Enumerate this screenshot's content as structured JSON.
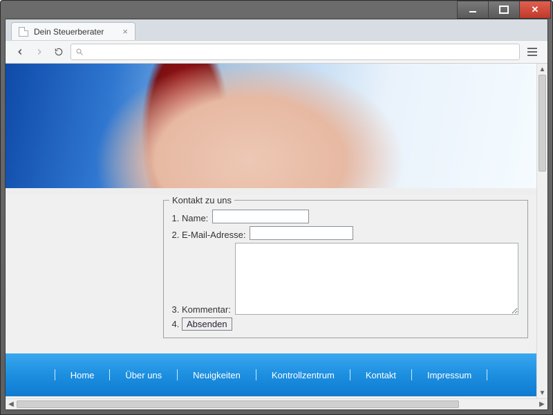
{
  "browser": {
    "tab_title": "Dein Steuerberater",
    "address": ""
  },
  "form": {
    "legend": "Kontakt zu uns",
    "name_label": "Name:",
    "email_label": "E-Mail-Adresse:",
    "comment_label": "Kommentar:",
    "submit_label": "Absenden",
    "name_value": "",
    "email_value": "",
    "comment_value": ""
  },
  "footer": {
    "items": [
      "Home",
      "Über uns",
      "Neuigkeiten",
      "Kontrollzentrum",
      "Kontakt",
      "Impressum"
    ]
  }
}
